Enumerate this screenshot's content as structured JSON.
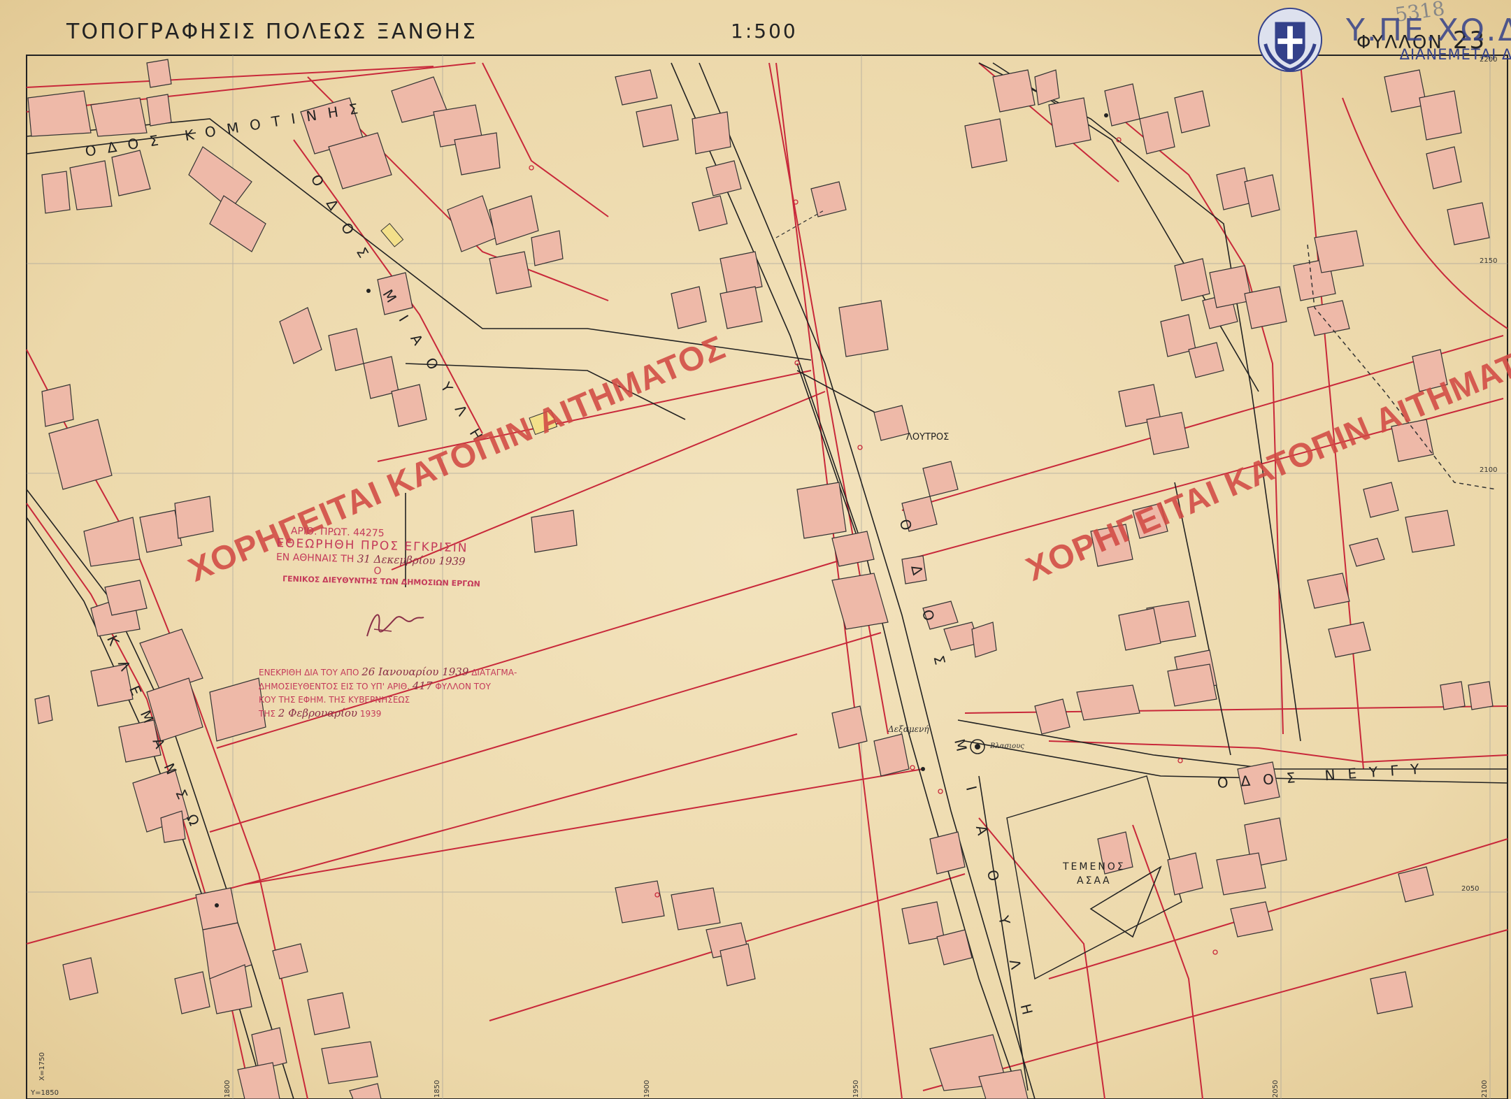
{
  "header": {
    "title": "ΤΟΠΟΓΡΑΦΗΣΙΣ ΠΟΛΕΩΣ ΞΑΝΘΗΣ",
    "scale": "1:500",
    "sheet_label": "ΦΥΛΛΟΝ",
    "sheet_number": "23",
    "handwritten_number": "5318"
  },
  "agency": {
    "name": "Υ.ΠΕ.ΧΩ.Δ.Ε.",
    "note": "ΔΙΑΝΕΜΕΤΑΙ ΔΩΡΕΑΝ",
    "seal_icon": "greek-coat-of-arms-icon"
  },
  "streets": {
    "komotinis": "ΟΔΟΣ ΚΟΜΟΤΙΝΗΣ",
    "miaouli_upper": "ΟΔΟΣ ΜΙΑΟΥΛΗ",
    "miaouli_lower": "ΟΔΟΣ ΜΙΑΟΥΛΗ",
    "kleman": "ΚΛΕΜΑΝΣΩ",
    "neygy": "ΟΔΟΣ ΝΕΥΓΥ"
  },
  "places": {
    "loutros": "ΛΟΥΤΡΟΣ",
    "temenos_line1": "ΤΕΜΕΝΟΣ",
    "temenos_line2": "ΑΣΑΑ",
    "dexameni": "Δεξαμενή",
    "vrysi": "Βλασιους"
  },
  "watermark": "ΧΟΡΗΓΕΙΤΑΙ ΚΑΤΟΠΙΝ ΑΙΤΗΜΑΤΟΣ",
  "stamp": {
    "protocol": "ΑΡΙΘ. ΠΡΩΤ. 44275",
    "line1": "ΕΘΕΩΡΗΘΗ ΠΡΟΣ ΕΓΚΡΙΣΙΝ",
    "line2": "ΕΝ ΑΘΗΝΑΙΣ ΤΗ",
    "date_handwritten": "31 Δεκεμβρίου 1939",
    "line3": "Ο",
    "line4": "ΓΕΝΙΚΟΣ ΔΙΕΥΘΥΝΤΗΣ ΤΩΝ ΔΗΜΟΣΙΩΝ ΕΡΓΩΝ"
  },
  "approval": {
    "line1": "ΕΝΕΚΡΙΘΗ ΔΙΑ ΤΟΥ ΑΠΟ",
    "line1_hw": "26 Ιανουαρίου 1939",
    "line1_end": "ΔΙΑΤΑΓΜΑ-",
    "line2": "ΔΗΜΟΣΙΕΥΘΕΝΤΟΣ ΕΙΣ ΤΟ ΥΠ' ΑΡΙΘ.",
    "line2_hw": "417",
    "line2_end": "ΦΥΛΛΟΝ ΤΟΥ",
    "line3": "ΚΟΥ ΤΗΣ ΕΦΗΜ. ΤΗΣ ΚΥΒΕΡΝΗΣΕΩΣ",
    "line4": "ΤΗΣ",
    "line4_hw": "2 Φεβρουαρίου",
    "line4_year": "1939"
  },
  "grid_labels": {
    "y2150": "2150",
    "y2100": "2100",
    "y2050": "2050",
    "y2200": "2200",
    "x1800": "1800",
    "x1850": "1850",
    "x1900": "1900",
    "x1950": "1950",
    "x2050": "2050",
    "x2100": "2100",
    "corner_x": "X=1750",
    "corner_y": "Y=1850"
  },
  "colors": {
    "paper": "#efdcb0",
    "building_fill": "#eeb9a8",
    "red_line": "#c8283a",
    "ink": "#222222",
    "watermark": "#d24a44",
    "stamp": "#c43a5a",
    "agency_blue": "#34418a"
  }
}
